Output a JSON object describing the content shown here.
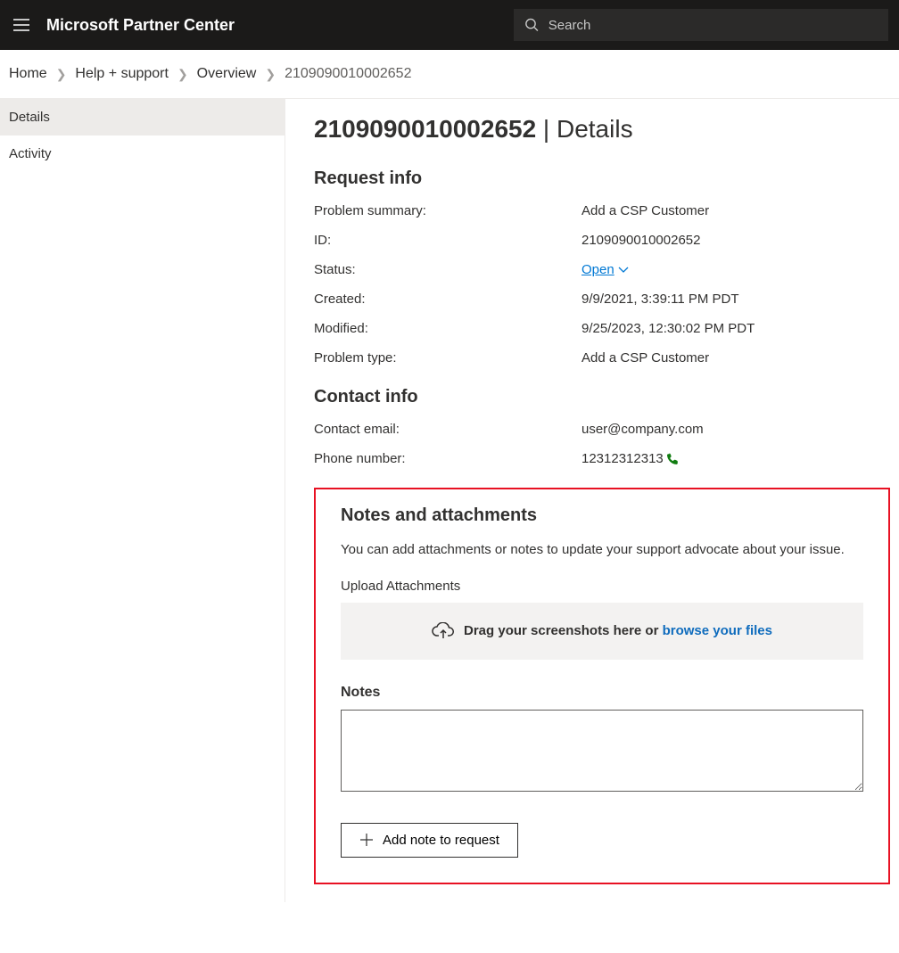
{
  "header": {
    "brand": "Microsoft Partner Center",
    "search_placeholder": "Search"
  },
  "breadcrumb": {
    "items": [
      "Home",
      "Help + support",
      "Overview",
      "2109090010002652"
    ]
  },
  "sidenav": {
    "items": [
      {
        "label": "Details",
        "active": true
      },
      {
        "label": "Activity",
        "active": false
      }
    ]
  },
  "page": {
    "title_id": "2109090010002652",
    "title_suffix": " | Details"
  },
  "request_info": {
    "heading": "Request info",
    "rows": {
      "problem_summary_label": "Problem summary:",
      "problem_summary_value": "Add a CSP Customer",
      "id_label": "ID:",
      "id_value": "2109090010002652",
      "status_label": "Status:",
      "status_value": "Open",
      "created_label": "Created:",
      "created_value": "9/9/2021, 3:39:11 PM PDT",
      "modified_label": "Modified:",
      "modified_value": "9/25/2023, 12:30:02 PM PDT",
      "problem_type_label": "Problem type:",
      "problem_type_value": "Add a CSP Customer"
    }
  },
  "contact_info": {
    "heading": "Contact info",
    "email_label": "Contact email:",
    "email_value": "user@company.com",
    "phone_label": "Phone number:",
    "phone_value": "12312312313"
  },
  "notes": {
    "heading": "Notes and attachments",
    "description": "You can add attachments or notes to update your support advocate about your issue.",
    "upload_label": "Upload Attachments",
    "dropzone_text": "Drag your screenshots here or ",
    "dropzone_browse": "browse your files",
    "notes_label": "Notes",
    "add_button": "Add note to request"
  }
}
